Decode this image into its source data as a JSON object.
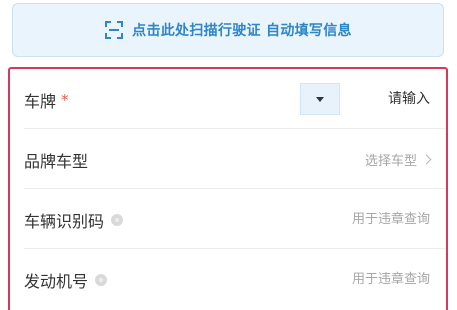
{
  "scan_banner": {
    "text": "点击此处扫描行驶证 自动填写信息",
    "icon": "scan-icon"
  },
  "form": {
    "plate": {
      "label": "车牌",
      "required_mark": "*",
      "province_value": "",
      "placeholder": "请输入"
    },
    "brand_model": {
      "label": "品牌车型",
      "value": "选择车型"
    },
    "vin": {
      "label": "车辆识别码",
      "placeholder": "用于违章查询"
    },
    "engine": {
      "label": "发动机号",
      "placeholder": "用于违章查询"
    }
  },
  "colors": {
    "accent_blue": "#2d86c9",
    "banner_bg": "#e9f4fc",
    "highlight_border": "#d43a5e",
    "required_red": "#e65a4a",
    "placeholder_gray": "#a6a6a6"
  }
}
